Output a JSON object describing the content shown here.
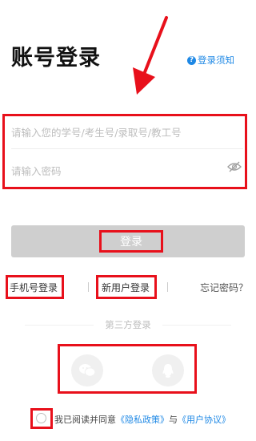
{
  "header": {
    "title": "账号登录",
    "notice_label": "登录须知",
    "notice_icon": "?"
  },
  "form": {
    "account_placeholder": "请输入您的学号/考生号/录取号/教工号",
    "password_placeholder": "请输入密码",
    "login_label": "登录"
  },
  "links": {
    "phone_login": "手机号登录",
    "new_user_login": "新用户登录",
    "forgot_password": "忘记密码？"
  },
  "third_party": {
    "title": "第三方登录",
    "icons": [
      "wechat-icon",
      "qq-icon"
    ]
  },
  "agreement": {
    "prefix": "我已阅读并同意",
    "privacy": "《隐私政策》",
    "and": "与",
    "user_agreement": "《用户协议》"
  },
  "colors": {
    "accent": "#1e88e5",
    "highlight": "#e8101b",
    "button_disabled": "#cfcfcf"
  }
}
